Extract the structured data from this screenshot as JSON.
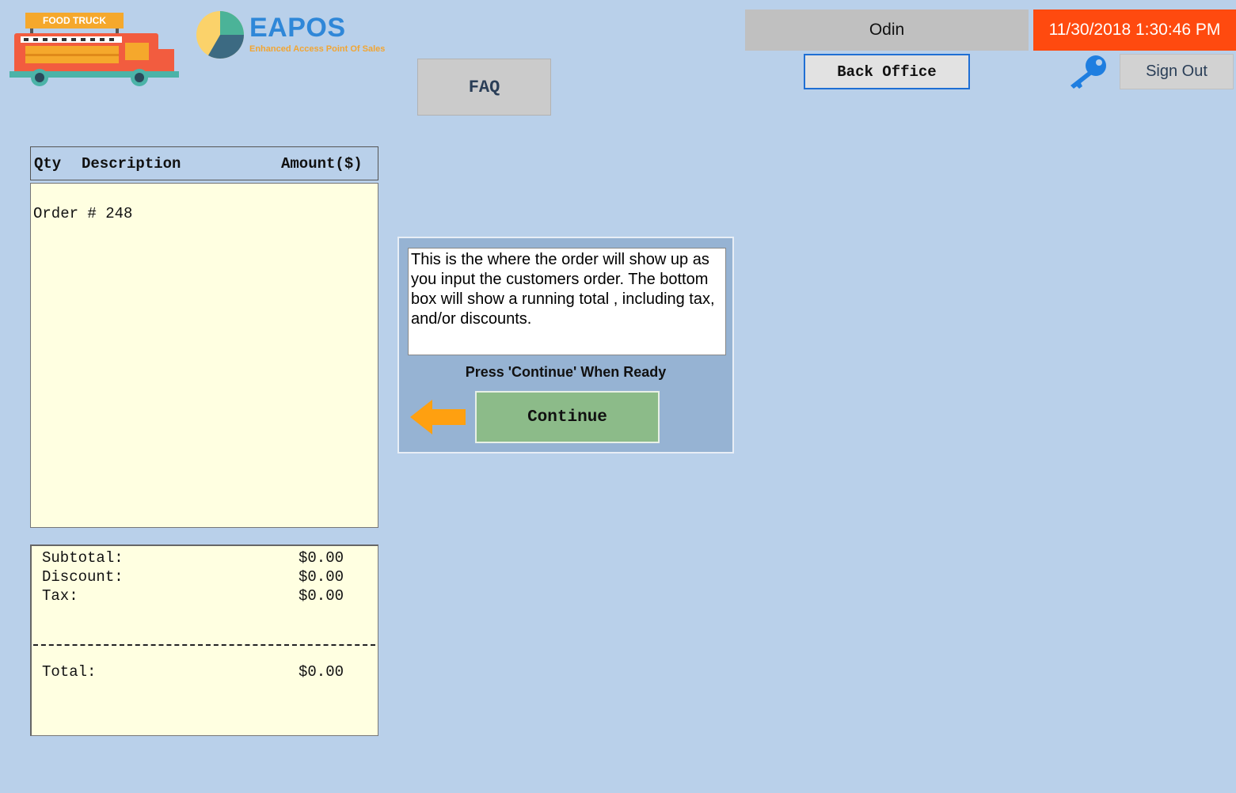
{
  "logo": {
    "food_truck_sign": "FOOD TRUCK",
    "brand_name": "EAPOS",
    "brand_tagline": "Enhanced Access Point Of Sales"
  },
  "header": {
    "faq_label": "FAQ",
    "user_name": "Odin",
    "datetime": "11/30/2018 1:30:46 PM",
    "back_office_label": "Back Office",
    "sign_out_label": "Sign Out",
    "key_icon": "key-icon"
  },
  "order": {
    "columns": {
      "qty": "Qty",
      "description": "Description",
      "amount": "Amount($)"
    },
    "order_number": "Order # 248"
  },
  "totals": {
    "subtotal_label": "Subtotal:",
    "subtotal_value": "$0.00",
    "discount_label": "Discount:",
    "discount_value": "$0.00",
    "tax_label": "Tax:",
    "tax_value": "$0.00",
    "total_label": "Total:",
    "total_value": "$0.00"
  },
  "tutorial": {
    "text": "This is the where the order will show up as you input the customers order. The bottom box will show a running total , including tax, and/or discounts.",
    "prompt": "Press 'Continue' When Ready",
    "continue_label": "Continue"
  },
  "colors": {
    "background": "#b9d0ea",
    "datetime_bg": "#ff4a0f",
    "continue_bg": "#8cbb89",
    "brand_blue": "#2f87d8",
    "brand_orange": "#f2a532"
  }
}
